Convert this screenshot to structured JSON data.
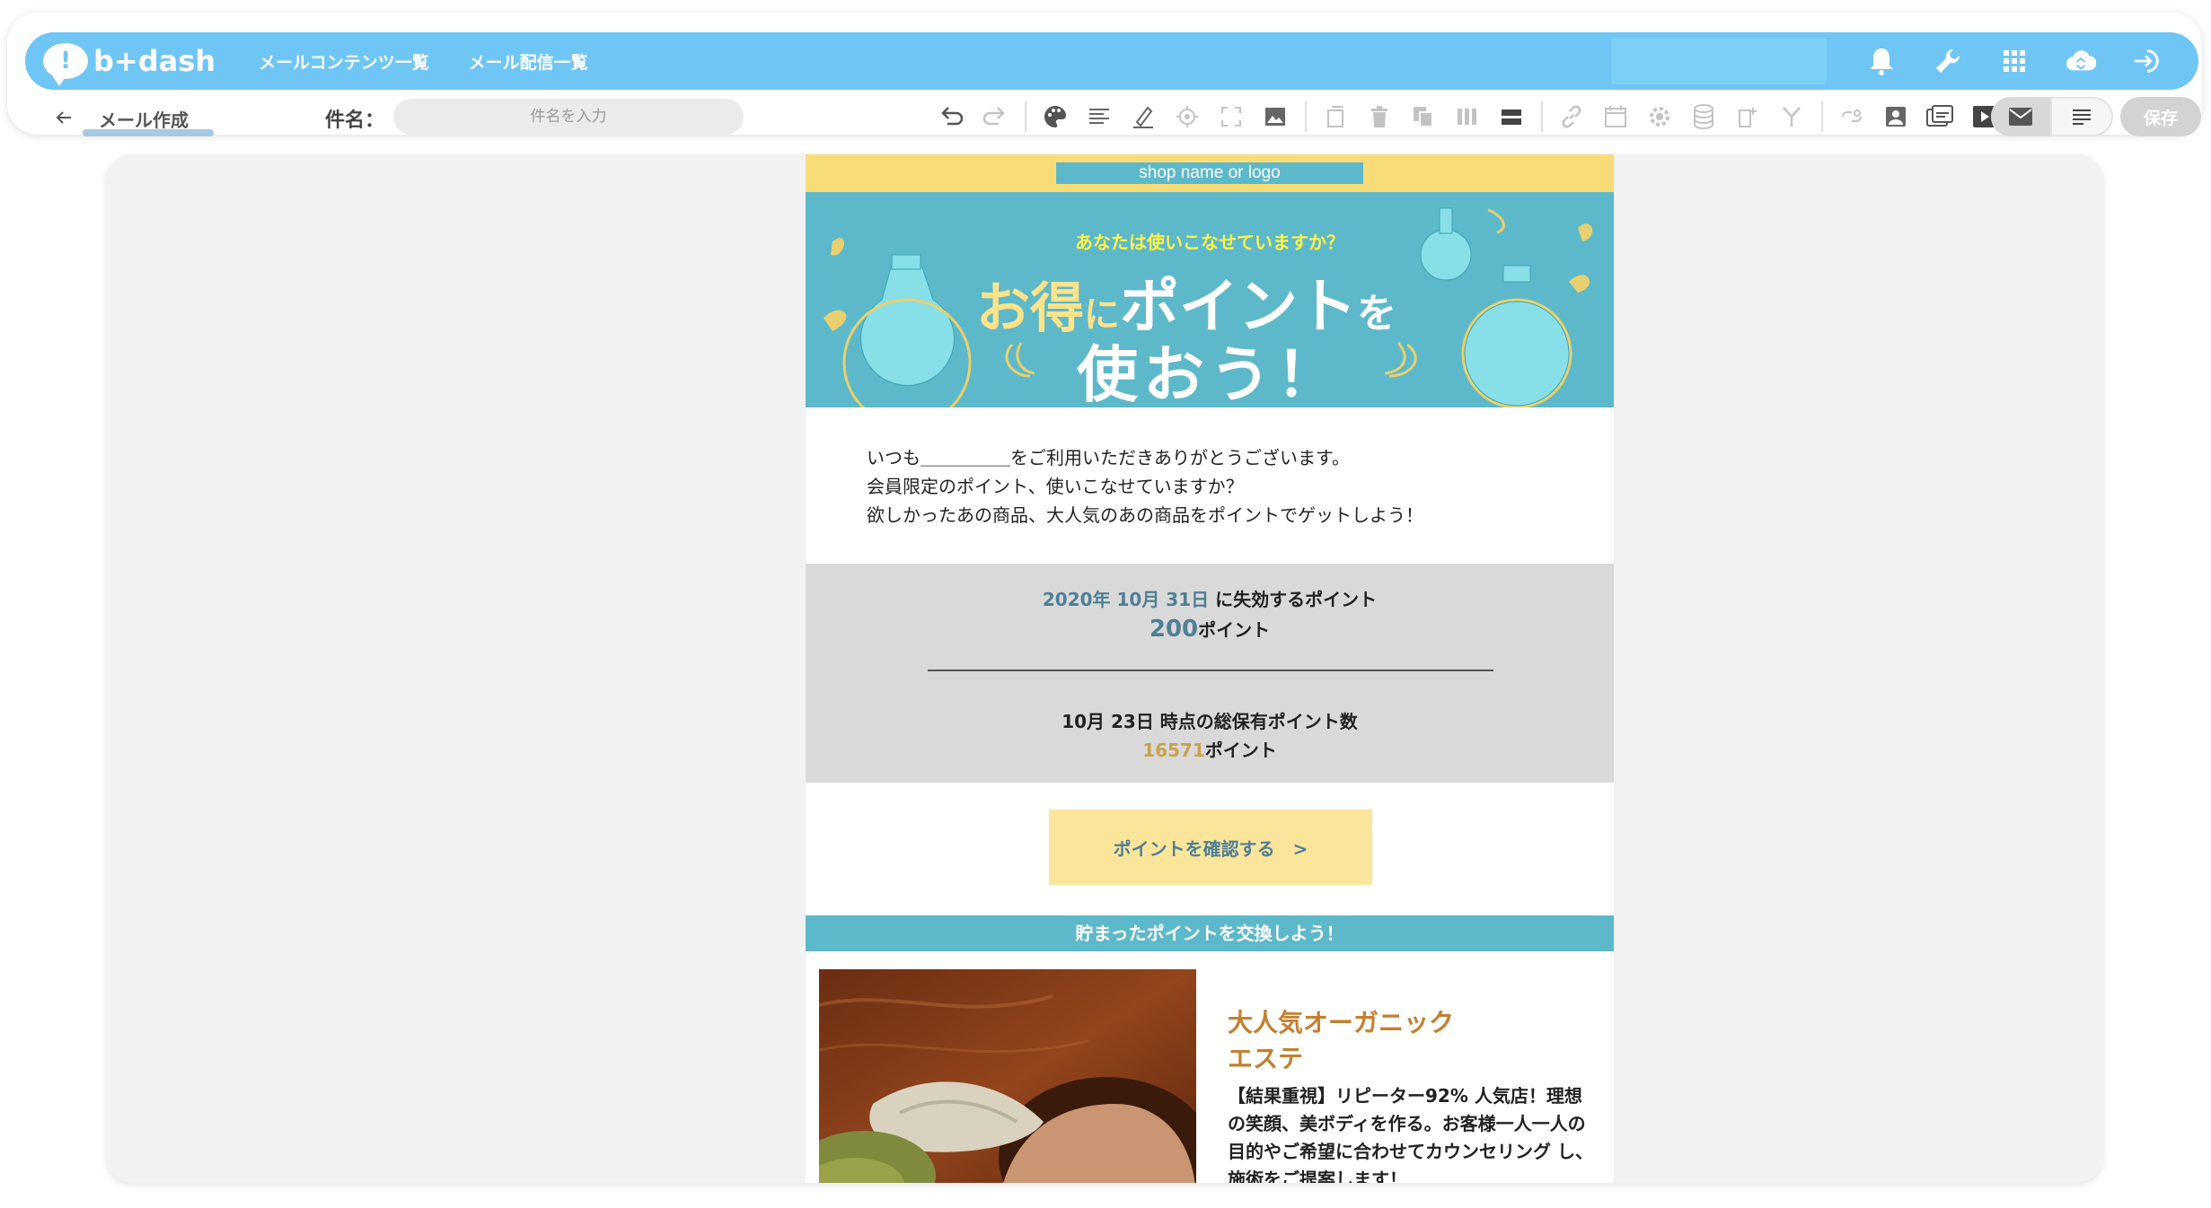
{
  "header": {
    "logo_text": "b+dash",
    "nav": [
      "メールコンテンツ一覧",
      "メール配信一覧"
    ],
    "icons": [
      "bell-icon",
      "wrench-icon",
      "apps-grid-icon",
      "cloud-sync-icon",
      "logout-icon"
    ]
  },
  "toolbar": {
    "title": "メール作成",
    "subject_label": "件名：",
    "subject_placeholder": "件名を入力",
    "subject_value": "",
    "save_label": "保存",
    "tools": [
      "undo-icon",
      "redo-icon",
      "palette-icon",
      "align-icon",
      "highlight-icon",
      "target-icon",
      "fullscreen-icon",
      "image-icon",
      "copy-block-icon",
      "trash-icon",
      "duplicate-icon",
      "columns-icon",
      "rows-icon",
      "link-icon",
      "calendar-icon",
      "gear-icon",
      "database-icon",
      "edit-note-icon",
      "merge-icon",
      "link-settings-icon",
      "person-card-icon",
      "preview-icon",
      "video-icon"
    ],
    "view_modes": [
      "mail-view-icon",
      "text-view-icon"
    ]
  },
  "mail": {
    "shop_label": "shop name or logo",
    "hero": {
      "question": "あなたは使いこなせていますか？",
      "line1_a": "お得",
      "line1_b": "に",
      "line1_c": "ポイント",
      "line1_d": "を",
      "line2": "使おう！"
    },
    "greeting": [
      "いつも＿＿＿＿＿をご利用いただきありがとうございます。",
      "会員限定のポイント、使いこなせていますか？",
      "欲しかったあの商品、大人気のあの商品をポイントでゲットしよう！"
    ],
    "points": {
      "expire_date": "2020年 10月 31日",
      "expire_text": " に失効するポイント",
      "expire_value": "200",
      "unit": "ポイント",
      "total_text": "10月 23日 時点の総保有ポイント数",
      "total_value": "16571"
    },
    "cta_label": "ポイントを確認する　>",
    "exchange_label": "貯まったポイントを交換しよう！",
    "product": {
      "title": "大人気オーガニック\nエステ",
      "description": "【結果重視】リピーター92% 人気店！理想の笑顔、美ボディを作る。お客様一人一人の目的やご希望に合わせてカウンセリング し、施術をご提案します！"
    }
  }
}
